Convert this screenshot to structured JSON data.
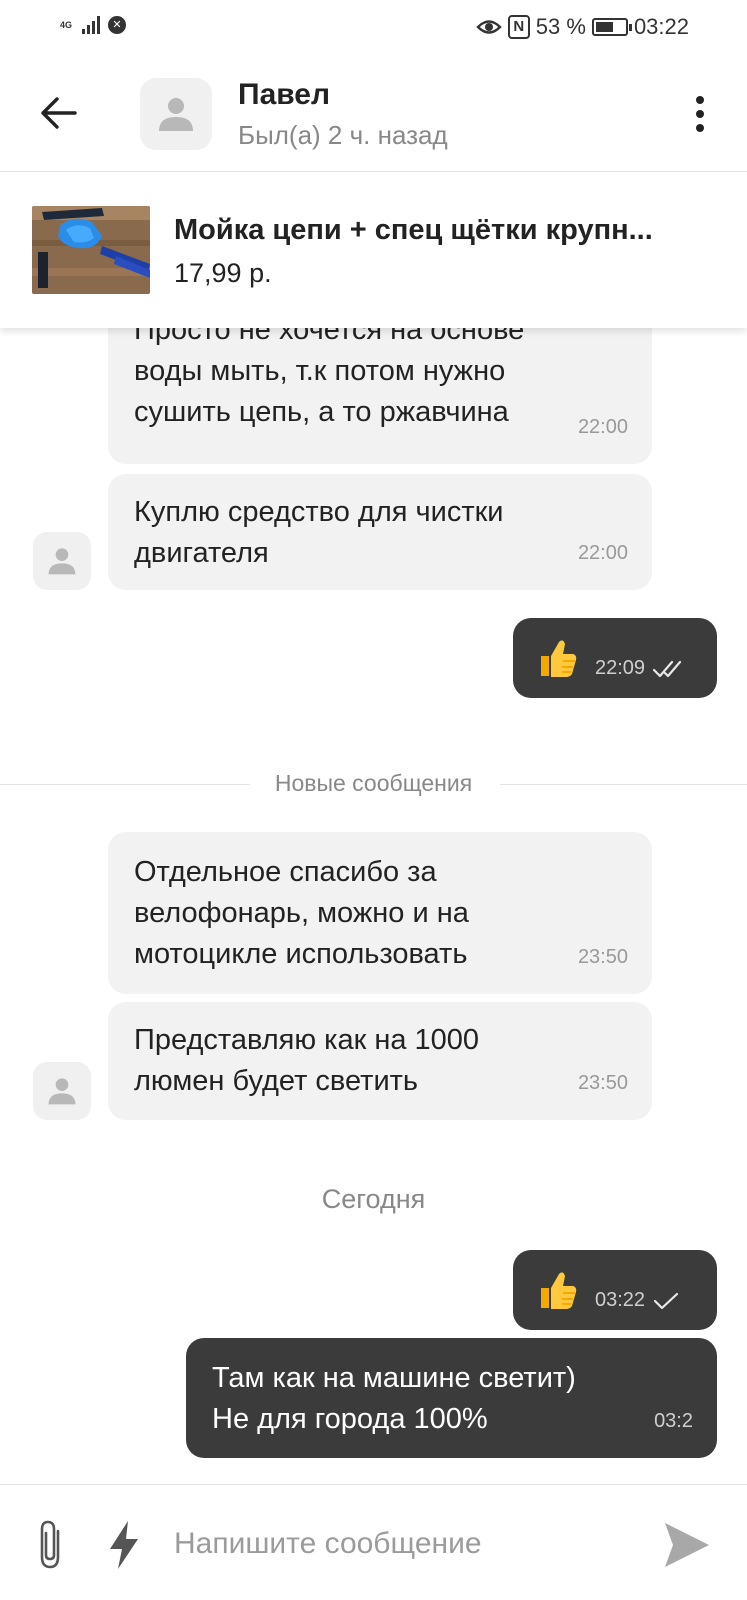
{
  "status_bar": {
    "network": "4G",
    "battery": "53 %",
    "battery_level": 0.53,
    "time": "03:22"
  },
  "header": {
    "contact_name": "Павел",
    "contact_status": "Был(а) 2 ч. назад",
    "back_icon": "arrow-back-icon",
    "more_icon": "more-vertical-icon"
  },
  "product": {
    "title": "Мойка цепи + спец щётки крупн...",
    "price": "17,99 р."
  },
  "messages": [
    {
      "direction": "in",
      "text": "Просто не хочется на основе\nводы мыть, т.к потом нужно\nсушить цепь, а то ржавчина",
      "time": "22:00"
    },
    {
      "direction": "in",
      "text": "Куплю средство для чистки\nдвигателя",
      "time": "22:00"
    },
    {
      "direction": "out",
      "emoji": "👍",
      "time": "22:09",
      "status_icon": "double-check-icon"
    },
    {
      "direction": "in",
      "text": "Отдельное спасибо за\nвелофонарь, можно и на\nмотоцикле использовать",
      "time": "23:50"
    },
    {
      "direction": "in",
      "text": "Представляю как на 1000\nлюмен будет светить",
      "time": "23:50"
    },
    {
      "direction": "out",
      "emoji": "👍",
      "time": "03:22",
      "status_icon": "check-icon"
    },
    {
      "direction": "out",
      "text": "Там как на машине светит)\nНе для города 100%",
      "time": "03:2"
    }
  ],
  "dividers": {
    "new_messages": "Новые сообщения",
    "today": "Сегодня"
  },
  "composer": {
    "placeholder": "Напишите сообщение",
    "attach_icon": "paperclip-icon",
    "quick_icon": "lightning-icon",
    "send_icon": "send-icon"
  },
  "colors": {
    "incoming_bubble": "#f2f2f2",
    "outgoing_bubble": "#3b3b3b",
    "muted_text": "#888888"
  }
}
